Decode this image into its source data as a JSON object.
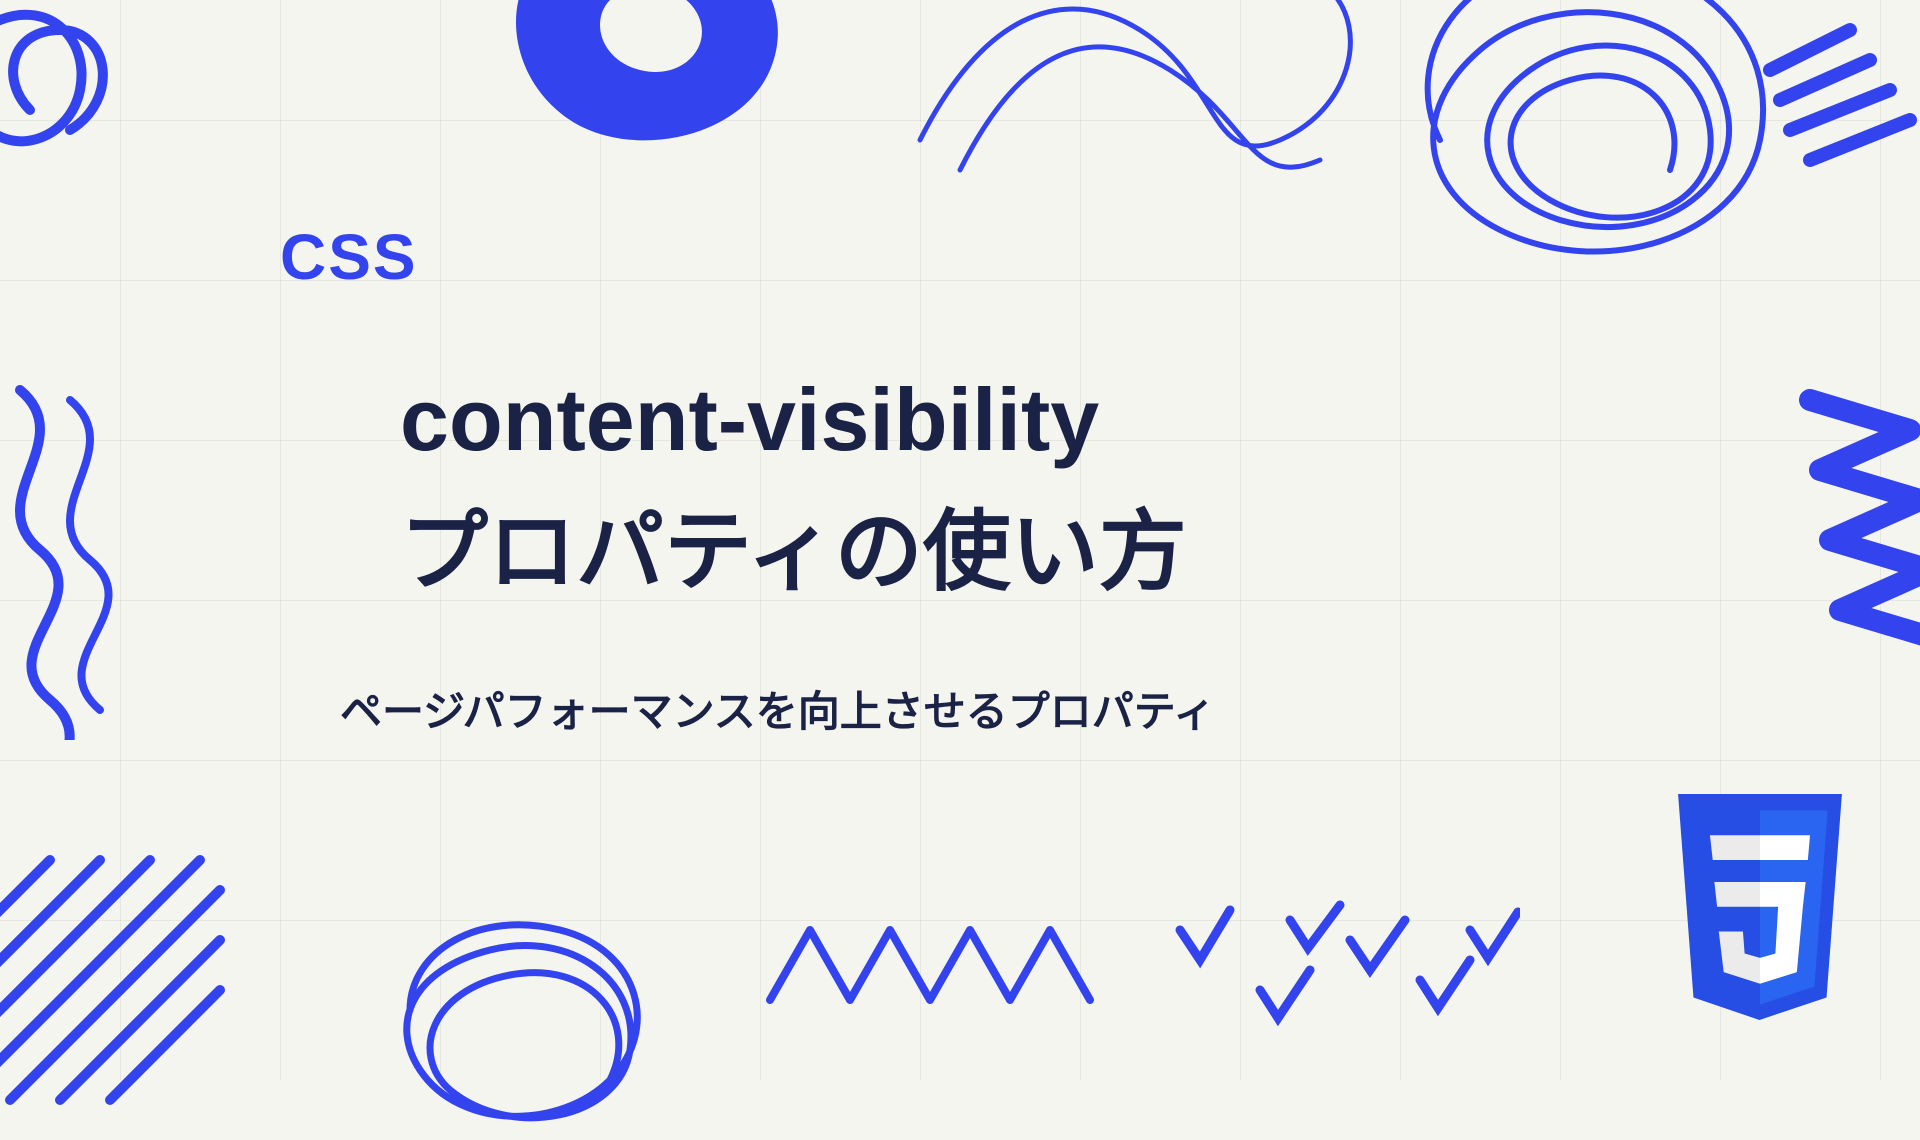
{
  "label": "CSS",
  "title_line1": "content-visibility",
  "title_line2": "プロパティの使い方",
  "subtitle": "ページパフォーマンスを向上させるプロパティ",
  "colors": {
    "accent": "#3344ee",
    "text": "#1a2245",
    "bg": "#f5f5f0"
  },
  "logo": "css3"
}
